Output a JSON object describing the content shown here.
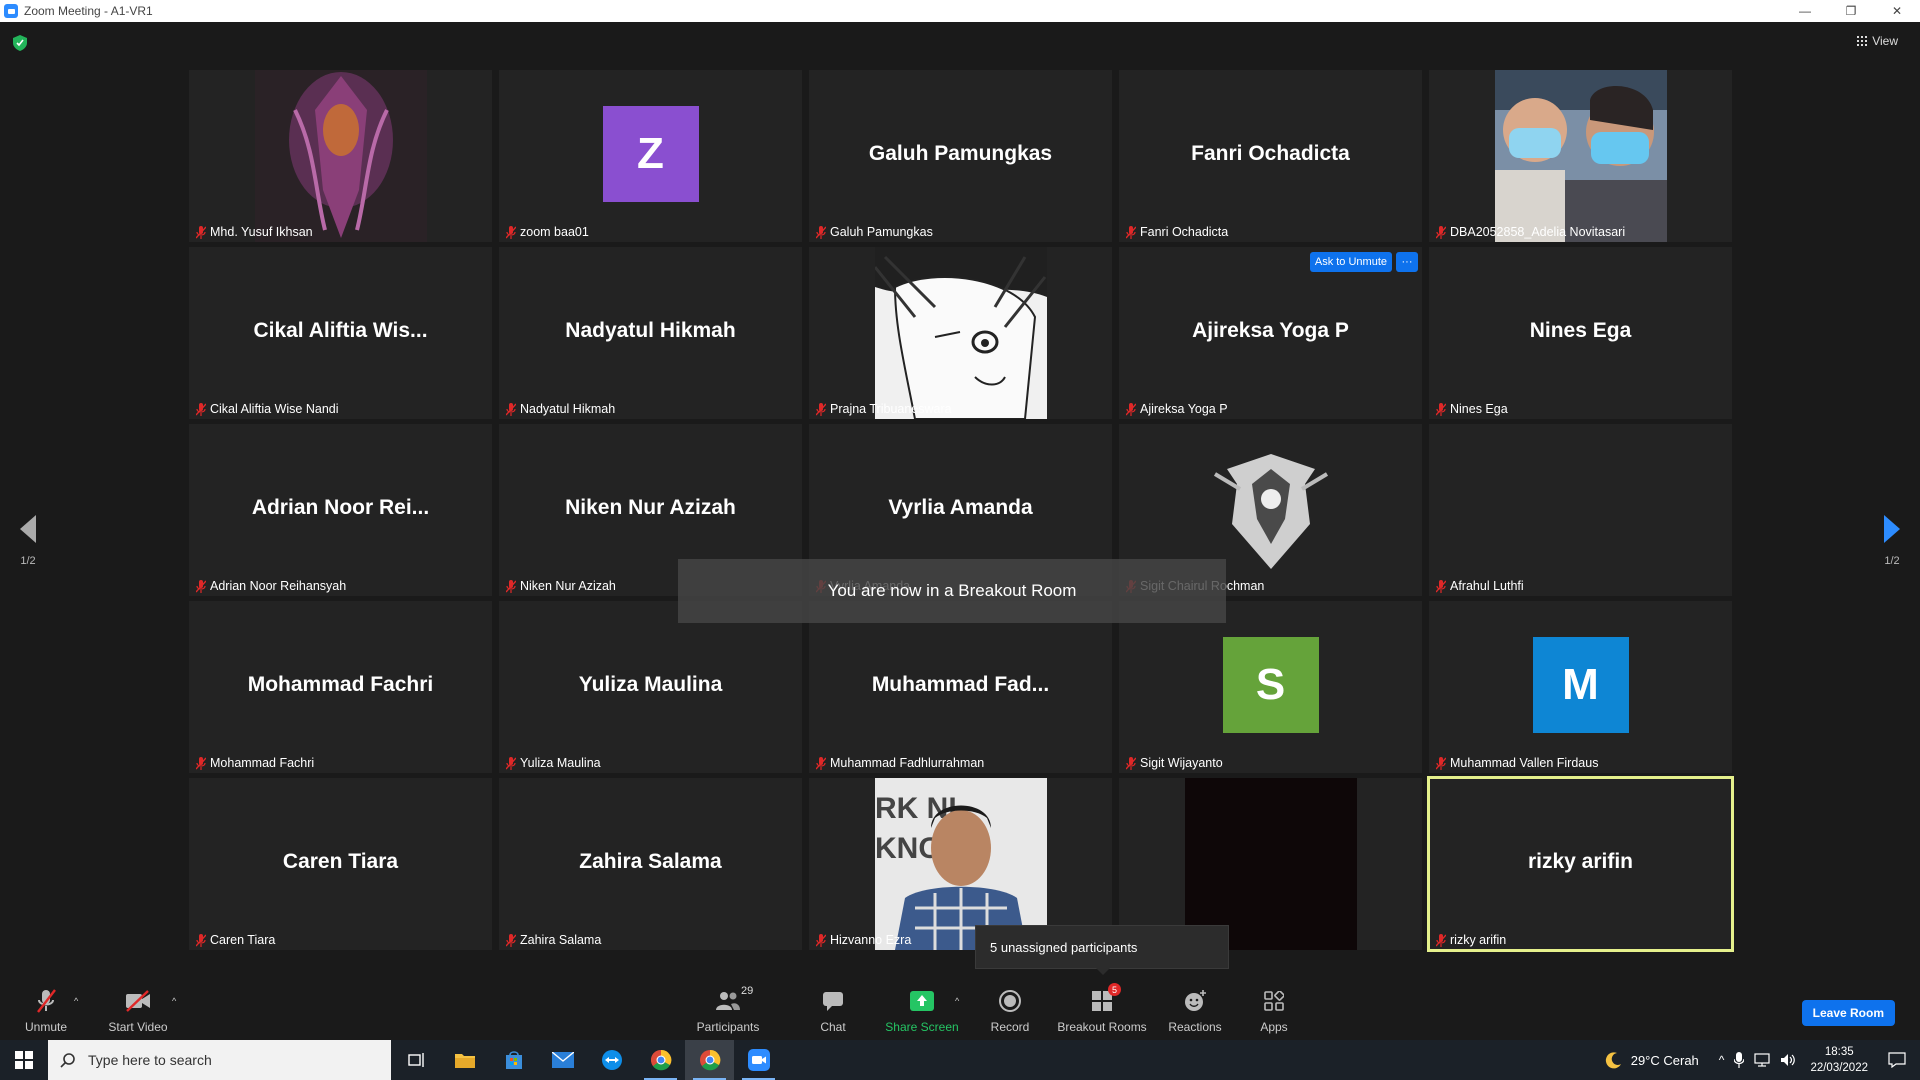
{
  "window": {
    "title": "Zoom Meeting - A1-VR1",
    "controls": [
      "—",
      "❐",
      "✕"
    ]
  },
  "top": {
    "view_label": "View"
  },
  "tiles": [
    {
      "label": "Mhd. Yusuf Ikhsan",
      "big": "",
      "kind": "pic-knight"
    },
    {
      "label": "zoom baa01",
      "big": "",
      "kind": "letter",
      "letter": "Z",
      "color": "#8a4fd0"
    },
    {
      "label": "Galuh Pamungkas",
      "big": "Galuh Pamungkas",
      "kind": "name"
    },
    {
      "label": "Fanri Ochadicta",
      "big": "Fanri Ochadicta",
      "kind": "name"
    },
    {
      "label": "DBA2052858_Adelia Novitasari",
      "big": "",
      "kind": "pic-masks"
    },
    {
      "label": "Cikal Aliftia Wise Nandi",
      "big": "Cikal  Aliftia  Wis...",
      "kind": "name"
    },
    {
      "label": "Nadyatul Hikmah",
      "big": "Nadyatul Hikmah",
      "kind": "name"
    },
    {
      "label": "Prajna Tribuaneswara",
      "big": "",
      "kind": "pic-manga"
    },
    {
      "label": "Ajireksa Yoga P",
      "big": "Ajireksa Yoga P",
      "kind": "name"
    },
    {
      "label": "Nines Ega",
      "big": "Nines Ega",
      "kind": "name"
    },
    {
      "label": "Adrian Noor Reihansyah",
      "big": "Adrian  Noor  Rei...",
      "kind": "name"
    },
    {
      "label": "Niken Nur Azizah",
      "big": "Niken Nur Azizah",
      "kind": "name"
    },
    {
      "label": "Vyrlia Amanda",
      "big": "Vyrlia Amanda",
      "kind": "name"
    },
    {
      "label": "Sigit Chairul Rochman",
      "big": "",
      "kind": "pic-emblem"
    },
    {
      "label": "Afrahul Luthfi",
      "big": "",
      "kind": "empty"
    },
    {
      "label": "Mohammad Fachri",
      "big": "Mohammad Fachri",
      "kind": "name"
    },
    {
      "label": "Yuliza Maulina",
      "big": "Yuliza Maulina",
      "kind": "name"
    },
    {
      "label": "Muhammad Fadhlurrahman",
      "big": "Muhammad  Fad...",
      "kind": "name"
    },
    {
      "label": "Sigit Wijayanto",
      "big": "",
      "kind": "letter",
      "letter": "S",
      "color": "#65a33a"
    },
    {
      "label": "Muhammad Vallen Firdaus",
      "big": "",
      "kind": "letter",
      "letter": "M",
      "color": "#0e86d4"
    },
    {
      "label": "Caren Tiara",
      "big": "Caren Tiara",
      "kind": "name"
    },
    {
      "label": "Zahira Salama",
      "big": "Zahira Salama",
      "kind": "name"
    },
    {
      "label": "Hizvanno Ezra",
      "big": "",
      "kind": "pic-photo"
    },
    {
      "label": "",
      "big": "",
      "kind": "pic-dark"
    },
    {
      "label": "rizky arifin",
      "big": "rizky arifin",
      "kind": "name",
      "active": true
    }
  ],
  "ask_unmute": "Ask to Unmute",
  "more_label": "···",
  "pager": {
    "left": "1/2",
    "right": "1/2"
  },
  "toast": "You are now in a Breakout Room",
  "unassigned": "5 unassigned participants",
  "toolbar": {
    "unmute": "Unmute",
    "start_video": "Start Video",
    "participants": "Participants",
    "participants_count": "29",
    "chat": "Chat",
    "share_screen": "Share Screen",
    "record": "Record",
    "breakout_rooms": "Breakout Rooms",
    "breakout_badge": "5",
    "reactions": "Reactions",
    "apps": "Apps",
    "leave_room": "Leave Room"
  },
  "taskbar": {
    "search_placeholder": "Type here to search",
    "weather": "29°C  Cerah",
    "time": "18:35",
    "date": "22/03/2022"
  }
}
